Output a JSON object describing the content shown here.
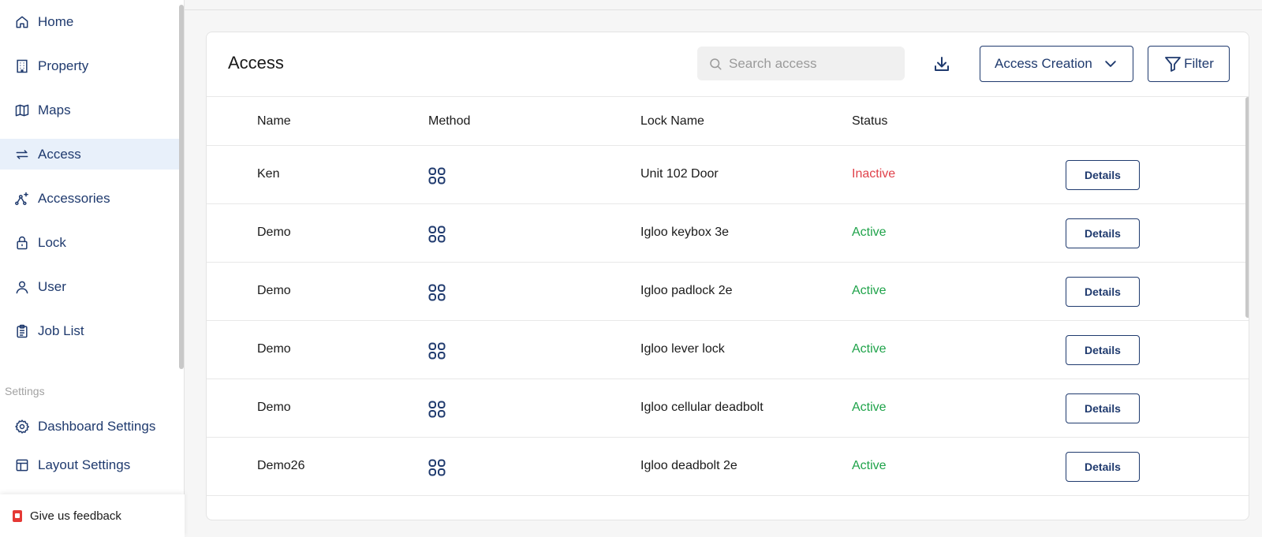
{
  "sidebar": {
    "items": [
      {
        "label": "Home",
        "icon": "home-icon"
      },
      {
        "label": "Property",
        "icon": "building-icon"
      },
      {
        "label": "Maps",
        "icon": "map-icon"
      },
      {
        "label": "Access",
        "icon": "swap-arrows-icon",
        "active": true
      },
      {
        "label": "Accessories",
        "icon": "network-icon"
      },
      {
        "label": "Lock",
        "icon": "lock-icon"
      },
      {
        "label": "User",
        "icon": "user-icon"
      },
      {
        "label": "Job List",
        "icon": "clipboard-icon"
      }
    ],
    "settings_heading": "Settings",
    "settings_items": [
      {
        "label": "Dashboard Settings",
        "icon": "gear-icon"
      },
      {
        "label": "Layout Settings",
        "icon": "layout-icon"
      }
    ],
    "feedback_label": "Give us feedback"
  },
  "card": {
    "title": "Access",
    "search_placeholder": "Search access",
    "access_creation_label": "Access Creation",
    "filter_label": "Filter"
  },
  "table": {
    "columns": [
      "Name",
      "Method",
      "Lock Name",
      "Status"
    ],
    "rows": [
      {
        "name": "Ken",
        "lock": "Unit 102 Door",
        "status": "Inactive",
        "action": "Details"
      },
      {
        "name": "Demo",
        "lock": "Igloo keybox 3e",
        "status": "Active",
        "action": "Details"
      },
      {
        "name": "Demo",
        "lock": "Igloo padlock 2e",
        "status": "Active",
        "action": "Details"
      },
      {
        "name": "Demo",
        "lock": "Igloo lever lock",
        "status": "Active",
        "action": "Details"
      },
      {
        "name": "Demo",
        "lock": "Igloo cellular deadbolt",
        "status": "Active",
        "action": "Details"
      },
      {
        "name": "Demo26",
        "lock": "Igloo deadbolt 2e",
        "status": "Active",
        "action": "Details"
      }
    ]
  },
  "colors": {
    "brand": "#1f3a6e",
    "active": "#1fa34a",
    "inactive": "#e0414a",
    "active_nav_bg": "#e8f0fa"
  }
}
